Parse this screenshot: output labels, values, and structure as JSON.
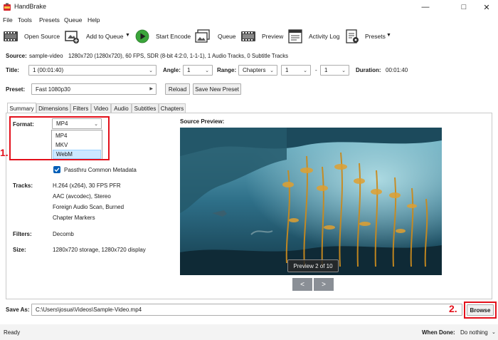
{
  "window": {
    "title": "HandBrake"
  },
  "menu": [
    "File",
    "Tools",
    "Presets",
    "Queue",
    "Help"
  ],
  "toolbar": {
    "open_source": "Open Source",
    "add_to_queue": "Add to Queue",
    "start_encode": "Start Encode",
    "queue": "Queue",
    "preview": "Preview",
    "activity_log": "Activity Log",
    "presets": "Presets"
  },
  "source": {
    "label": "Source:",
    "name": "sample-video",
    "details": "1280x720 (1280x720), 60 FPS, SDR (8-bit 4:2:0, 1-1-1), 1 Audio Tracks, 0 Subtitle Tracks"
  },
  "title_row": {
    "title_label": "Title:",
    "title_value": "1  (00:01:40)",
    "angle_label": "Angle:",
    "angle_value": "1",
    "range_label": "Range:",
    "range_type": "Chapters",
    "range_start": "1",
    "range_dash": "-",
    "range_end": "1",
    "duration_label": "Duration:",
    "duration_value": "00:01:40"
  },
  "preset_row": {
    "label": "Preset:",
    "value": "Fast 1080p30",
    "reload": "Reload",
    "save_new": "Save New Preset"
  },
  "tabs": [
    "Summary",
    "Dimensions",
    "Filters",
    "Video",
    "Audio",
    "Subtitles",
    "Chapters"
  ],
  "summary": {
    "format_label": "Format:",
    "format_value": "MP4",
    "format_options": [
      "MP4",
      "MKV",
      "WebM"
    ],
    "passthru_label": "Passthru Common Metadata",
    "tracks_label": "Tracks:",
    "tracks": [
      "H.264 (x264), 30 FPS PFR",
      "AAC (avcodec), Stereo",
      "Foreign Audio Scan, Burned",
      "Chapter Markers"
    ],
    "filters_label": "Filters:",
    "filters_value": "Decomb",
    "size_label": "Size:",
    "size_value": "1280x720 storage, 1280x720 display",
    "source_preview_label": "Source Preview:",
    "preview_badge": "Preview 2 of 10",
    "prev_glyph": "<",
    "next_glyph": ">"
  },
  "save_as": {
    "label": "Save As:",
    "path": "C:\\Users\\josua\\Videos\\Sample-Video.mp4",
    "browse": "Browse"
  },
  "annotations": {
    "step1": "1.",
    "step2": "2."
  },
  "status": {
    "ready": "Ready",
    "when_done_label": "When Done:",
    "when_done_value": "Do nothing"
  },
  "colors": {
    "accent": "#005fb8",
    "annotation_red": "#e3101b",
    "play_green": "#3aa53a"
  }
}
